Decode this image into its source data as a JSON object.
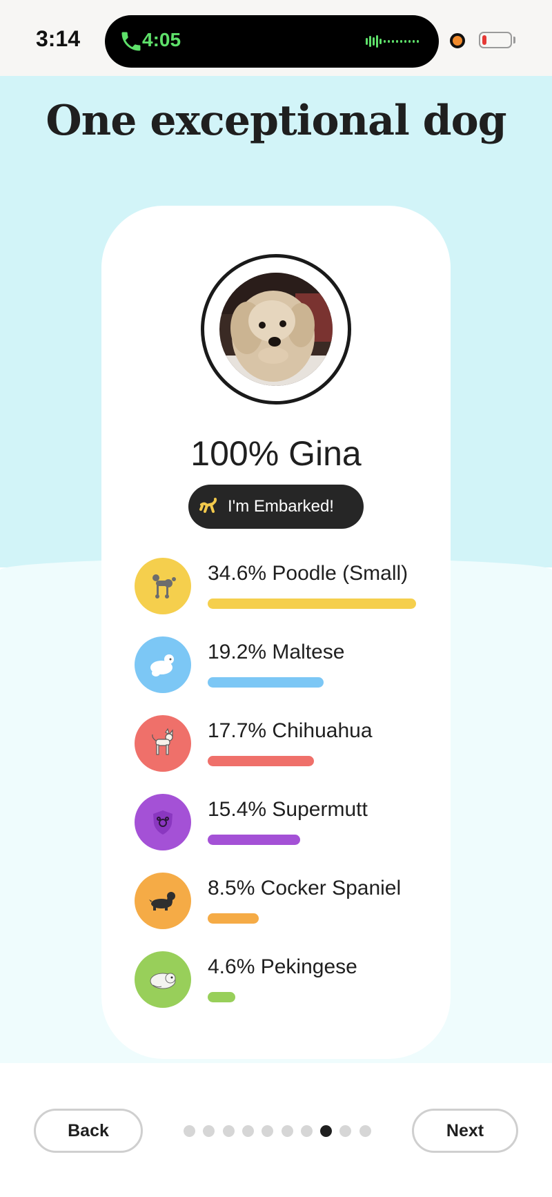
{
  "status": {
    "time": "3:14",
    "call_time": "4:05",
    "call_color": "#5ee06a",
    "battery_color": "#e53935"
  },
  "page": {
    "title": "One exceptional dog",
    "background_top": "#d2f4f8",
    "background_bottom": "#effcfd"
  },
  "profile": {
    "name": "100% Gina",
    "photo": "dog-photo-puppy",
    "badge": {
      "label": "I'm Embarked!",
      "icon": "balloon-dog-icon"
    }
  },
  "breeds": [
    {
      "label": "34.6% Poodle (Small)",
      "percent": 34.6,
      "color": "#f5cf4d",
      "icon": "poodle-icon"
    },
    {
      "label": "19.2% Maltese",
      "percent": 19.2,
      "color": "#7cc7f5",
      "icon": "maltese-icon"
    },
    {
      "label": "17.7% Chihuahua",
      "percent": 17.7,
      "color": "#ef706a",
      "icon": "chihuahua-icon"
    },
    {
      "label": "15.4% Supermutt",
      "percent": 15.4,
      "color": "#a451d6",
      "icon": "supermutt-shield-icon"
    },
    {
      "label": "8.5% Cocker Spaniel",
      "percent": 8.5,
      "color": "#f5ab46",
      "icon": "cocker-spaniel-icon"
    },
    {
      "label": "4.6% Pekingese",
      "percent": 4.6,
      "color": "#98cf5a",
      "icon": "pekingese-icon"
    }
  ],
  "footer": {
    "back_label": "Back",
    "next_label": "Next",
    "page_count": 10,
    "current_page": 8
  }
}
